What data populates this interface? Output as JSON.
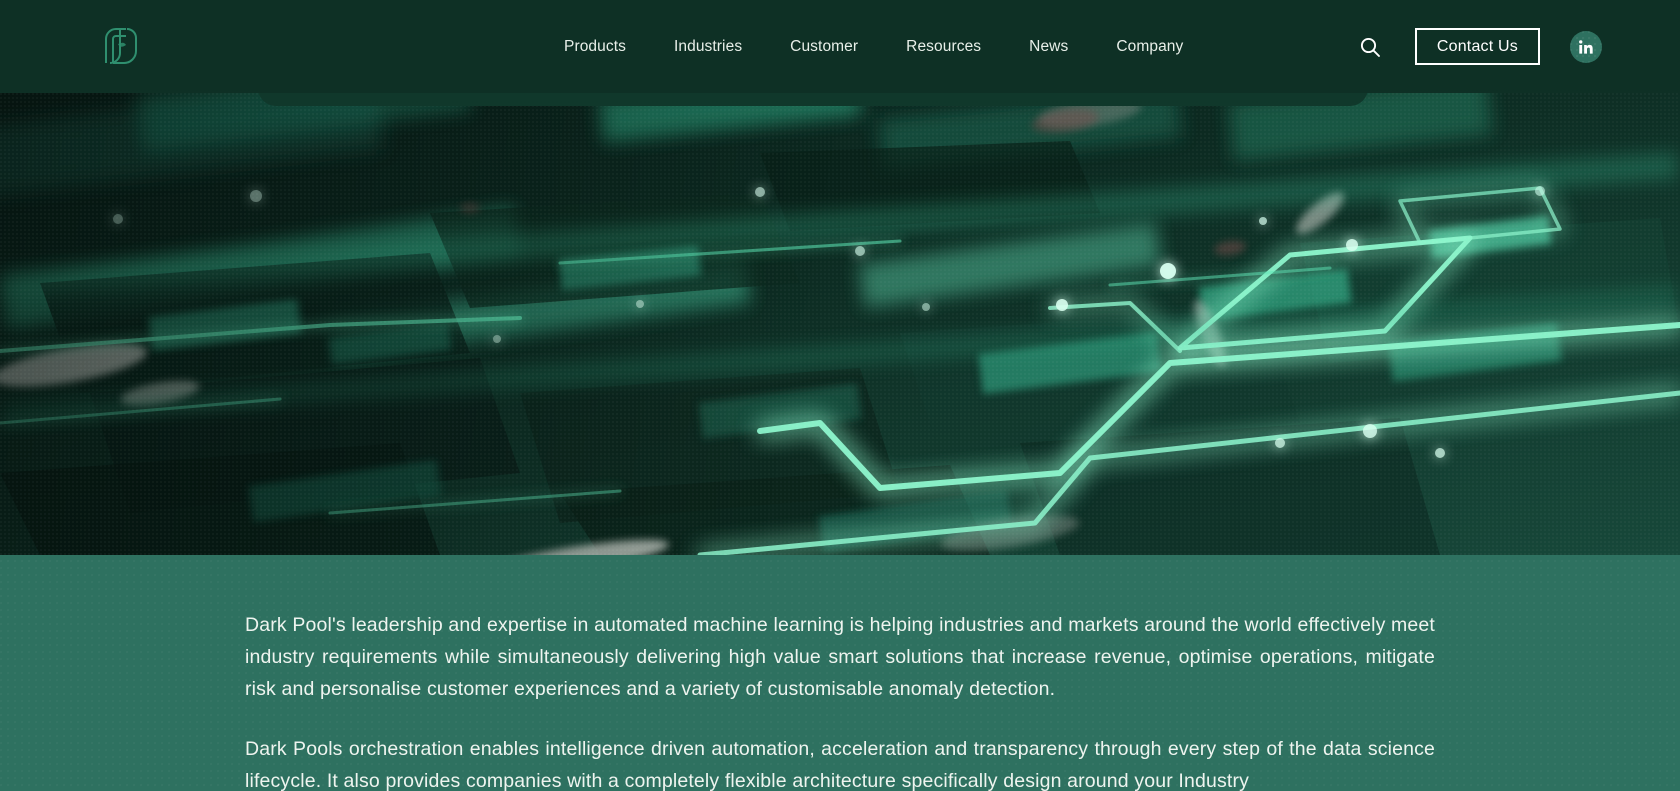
{
  "theme": {
    "header_bg": "#0e3025",
    "page_bg": "#2e7160",
    "accent_glow": "#55e3b0",
    "text_light": "#eef4ef",
    "button_border": "#ffffff"
  },
  "header": {
    "logo_name": "dark-pool-logo",
    "nav": [
      {
        "label": "Products"
      },
      {
        "label": "Industries"
      },
      {
        "label": "Customer"
      },
      {
        "label": "Resources"
      },
      {
        "label": "News"
      },
      {
        "label": "Company"
      }
    ],
    "search_icon": "search-icon",
    "contact_label": "Contact Us",
    "social": {
      "name": "linkedin-icon",
      "label": "in"
    }
  },
  "hero": {
    "alt": "circuit-board-with-glowing-green-traces"
  },
  "main": {
    "paragraphs": [
      "Dark Pool's leadership and expertise in automated machine learning is helping industries and markets around the world effectively meet industry requirements while simultaneously delivering high value smart solutions that increase revenue, optimise operations, mitigate risk and personalise customer experiences and a variety of customisable anomaly detection.",
      "Dark Pools orchestration enables intelligence driven automation, acceleration and transparency through every step of the data science lifecycle. It also provides companies with a completely flexible architecture specifically design around your Industry"
    ]
  }
}
